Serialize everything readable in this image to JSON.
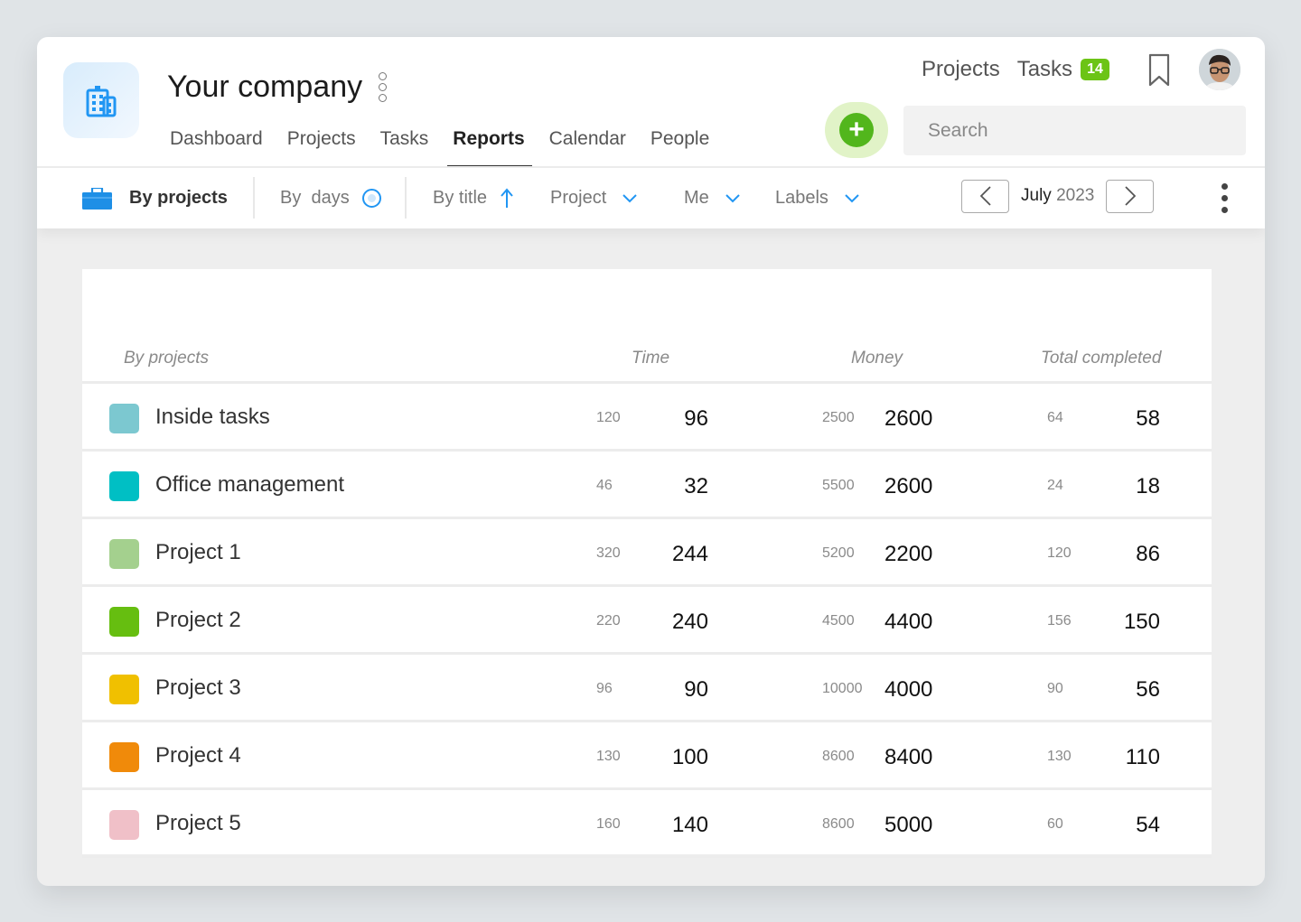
{
  "company": {
    "name": "Your company"
  },
  "nav": {
    "items": [
      {
        "label": "Dashboard",
        "active": false
      },
      {
        "label": "Projects",
        "active": false
      },
      {
        "label": "Tasks",
        "active": false
      },
      {
        "label": "Reports",
        "active": true
      },
      {
        "label": "Calendar",
        "active": false
      },
      {
        "label": "People",
        "active": false
      }
    ]
  },
  "top_links": {
    "projects": "Projects",
    "tasks": "Tasks",
    "tasks_badge": "14"
  },
  "search": {
    "placeholder": "Search",
    "value": ""
  },
  "toolbar": {
    "by_projects": "By projects",
    "by_days": "By  days",
    "by_title": "By title",
    "project": "Project",
    "me": "Me",
    "labels": "Labels",
    "month": "July",
    "year": "2023"
  },
  "icons": {
    "logo": "building-icon",
    "add": "plus-icon",
    "bookmark": "bookmark-icon",
    "briefcase": "briefcase-icon",
    "sort": "arrow-up-icon",
    "dropdown": "chevron-down-icon",
    "prev": "chevron-left-icon",
    "next": "chevron-right-icon",
    "more": "kebab-icon"
  },
  "colors": {
    "accent_blue": "#2196f3",
    "add_green": "#52b61c",
    "badge_green": "#6cc416"
  },
  "table": {
    "headers": {
      "project": "By projects",
      "time": "Time",
      "money": "Money",
      "total": "Total completed"
    },
    "rows": [
      {
        "name": "Inside tasks",
        "color": "#7cc8d0",
        "time_plan": "120",
        "time": "96",
        "money_plan": "2500",
        "money": "2600",
        "total_plan": "64",
        "total": "58"
      },
      {
        "name": "Office management",
        "color": "#00bfc4",
        "time_plan": "46",
        "time": "32",
        "money_plan": "5500",
        "money": "2600",
        "total_plan": "24",
        "total": "18"
      },
      {
        "name": "Project 1",
        "color": "#a4d08e",
        "time_plan": "320",
        "time": "244",
        "money_plan": "5200",
        "money": "2200",
        "total_plan": "120",
        "total": "86"
      },
      {
        "name": "Project 2",
        "color": "#66be10",
        "time_plan": "220",
        "time": "240",
        "money_plan": "4500",
        "money": "4400",
        "total_plan": "156",
        "total": "150"
      },
      {
        "name": "Project 3",
        "color": "#f0c000",
        "time_plan": "96",
        "time": "90",
        "money_plan": "10000",
        "money": "4000",
        "total_plan": "90",
        "total": "56"
      },
      {
        "name": "Project 4",
        "color": "#f08a0a",
        "time_plan": "130",
        "time": "100",
        "money_plan": "8600",
        "money": "8400",
        "total_plan": "130",
        "total": "110"
      },
      {
        "name": "Project 5",
        "color": "#f0c0c8",
        "time_plan": "160",
        "time": "140",
        "money_plan": "8600",
        "money": "5000",
        "total_plan": "60",
        "total": "54"
      }
    ]
  }
}
